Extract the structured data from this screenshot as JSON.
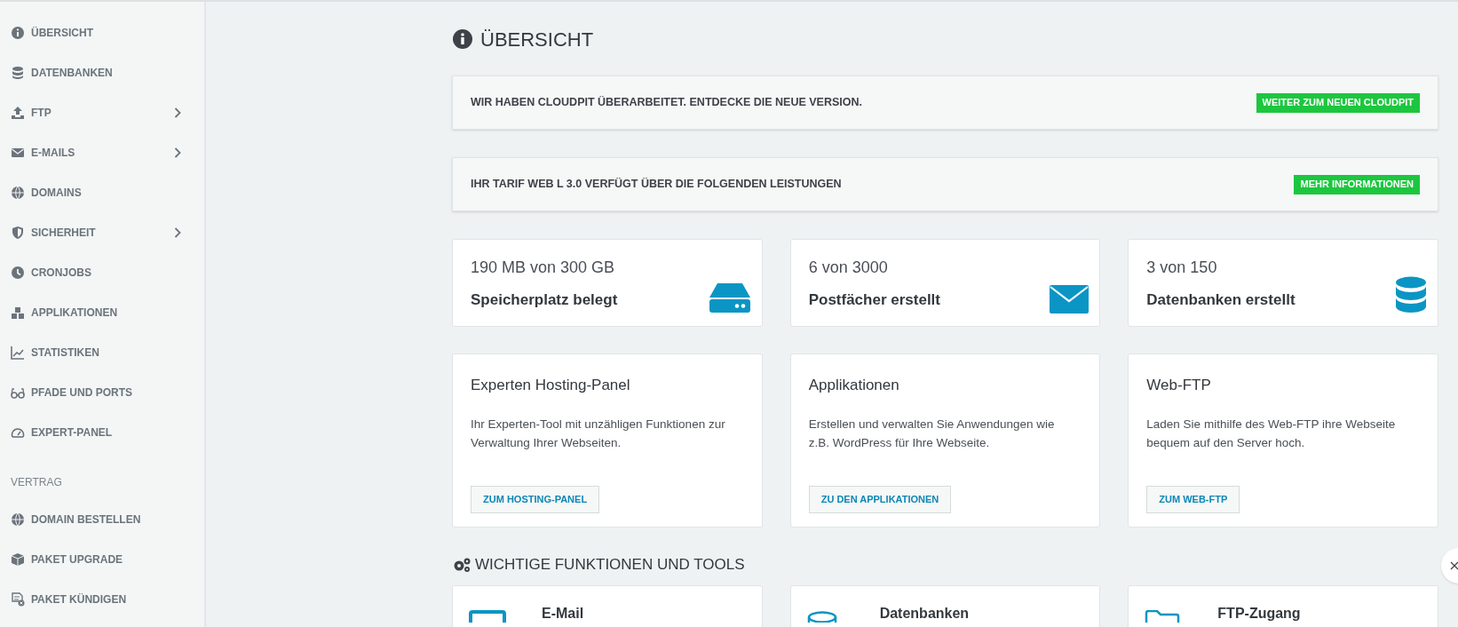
{
  "sidebar": {
    "items": [
      {
        "kind": "item",
        "label": "ÜBERSICHT",
        "has_submenu": false
      },
      {
        "kind": "item",
        "label": "DATENBANKEN",
        "has_submenu": false
      },
      {
        "kind": "item",
        "label": "FTP",
        "has_submenu": true
      },
      {
        "kind": "item",
        "label": "E-MAILS",
        "has_submenu": true
      },
      {
        "kind": "item",
        "label": "DOMAINS",
        "has_submenu": false
      },
      {
        "kind": "item",
        "label": "SICHERHEIT",
        "has_submenu": true
      },
      {
        "kind": "item",
        "label": "CRONJOBS",
        "has_submenu": false
      },
      {
        "kind": "item",
        "label": "APPLIKATIONEN",
        "has_submenu": false
      },
      {
        "kind": "item",
        "label": "STATISTIKEN",
        "has_submenu": false
      },
      {
        "kind": "item",
        "label": "PFADE UND PORTS",
        "has_submenu": false
      },
      {
        "kind": "item",
        "label": "EXPERT-PANEL",
        "has_submenu": false
      },
      {
        "kind": "section",
        "label": "VERTRAG"
      },
      {
        "kind": "item",
        "label": "DOMAIN BESTELLEN",
        "has_submenu": false
      },
      {
        "kind": "item",
        "label": "PAKET UPGRADE",
        "has_submenu": false
      },
      {
        "kind": "item",
        "label": "PAKET KÜNDIGEN",
        "has_submenu": false
      }
    ]
  },
  "page_title": "ÜBERSICHT",
  "banners": [
    {
      "text": "WIR HABEN CLOUDPIT ÜBERARBEITET. ENTDECKE DIE NEUE VERSION.",
      "button": "WEITER ZUM NEUEN CLOUDPIT"
    },
    {
      "text": "IHR TARIF WEB L 3.0 VERFÜGT ÜBER DIE FOLGENDEN LEISTUNGEN",
      "button": "MEHR INFORMATIONEN"
    }
  ],
  "stats": [
    {
      "value": "190 MB von 300 GB",
      "label": "Speicherplatz belegt"
    },
    {
      "value": "6 von 3000",
      "label": "Postfächer erstellt"
    },
    {
      "value": "3 von 150",
      "label": "Datenbanken erstellt"
    }
  ],
  "features": [
    {
      "title": "Experten Hosting-Panel",
      "text": "Ihr Experten-Tool mit unzähligen Funktionen zur Verwaltung Ihrer Webseiten.",
      "button": "ZUM HOSTING-PANEL"
    },
    {
      "title": "Applikationen",
      "text": "Erstellen und verwalten Sie Anwendungen wie z.B. WordPress für Ihre Webseite.",
      "button": "ZU DEN APPLIKATIONEN"
    },
    {
      "title": "Web-FTP",
      "text": "Laden Sie mithilfe des Web-FTP ihre Webseite bequem auf den Server hoch.",
      "button": "ZUM WEB-FTP"
    }
  ],
  "tools_heading": "WICHTIGE FUNKTIONEN UND TOOLS",
  "tools": [
    {
      "title": "E-Mail"
    },
    {
      "title": "Datenbanken"
    },
    {
      "title": "FTP-Zugang"
    }
  ]
}
